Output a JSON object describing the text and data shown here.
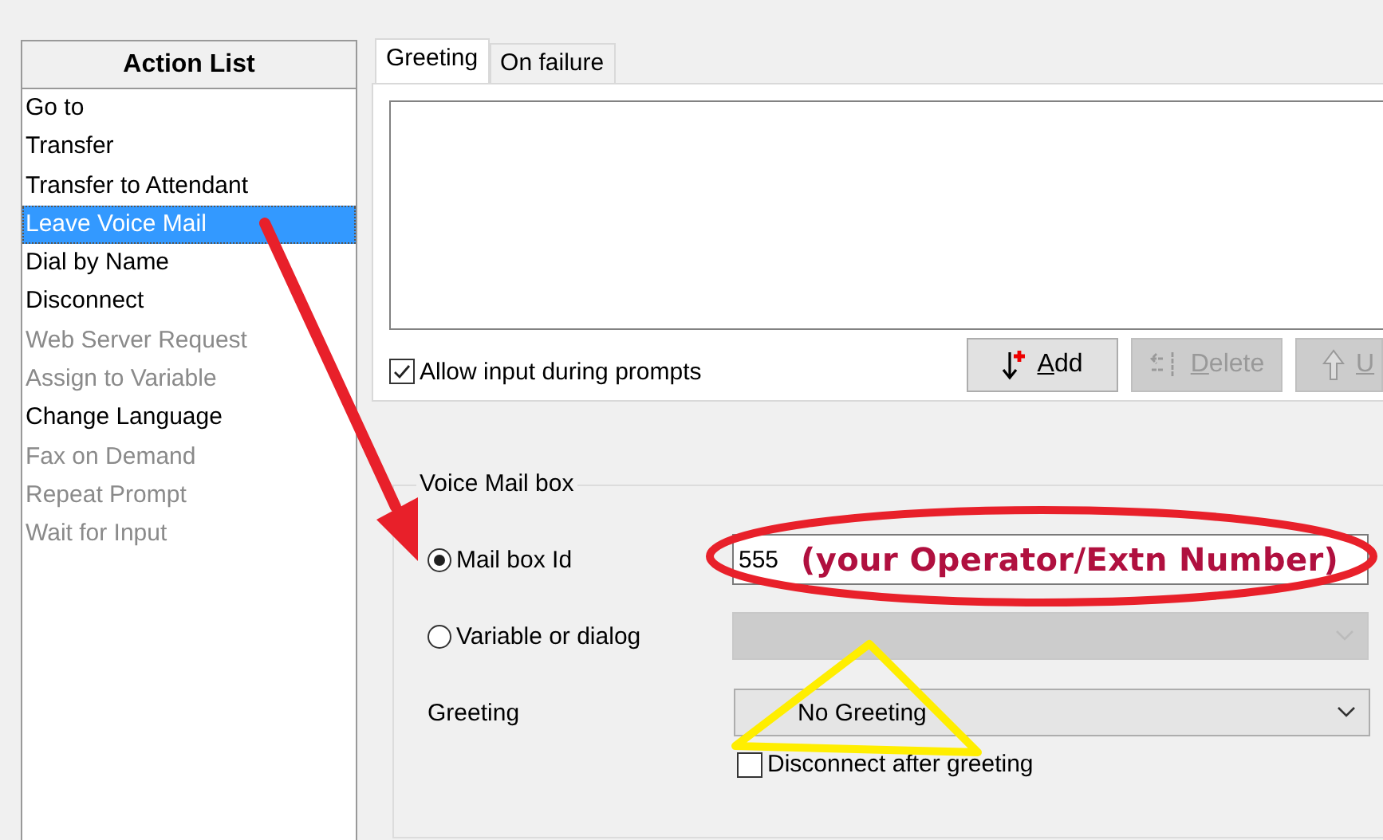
{
  "action_list": {
    "title": "Action List",
    "items": [
      {
        "label": "Go to",
        "selected": false,
        "disabled": false
      },
      {
        "label": "Transfer",
        "selected": false,
        "disabled": false
      },
      {
        "label": "Transfer to Attendant",
        "selected": false,
        "disabled": false
      },
      {
        "label": "Leave Voice Mail",
        "selected": true,
        "disabled": false
      },
      {
        "label": "Dial by Name",
        "selected": false,
        "disabled": false
      },
      {
        "label": "Disconnect",
        "selected": false,
        "disabled": false
      },
      {
        "label": "Web Server Request",
        "selected": false,
        "disabled": true
      },
      {
        "label": "Assign to Variable",
        "selected": false,
        "disabled": true
      },
      {
        "label": "Change Language",
        "selected": false,
        "disabled": false
      },
      {
        "label": "Fax on Demand",
        "selected": false,
        "disabled": true
      },
      {
        "label": "Repeat Prompt",
        "selected": false,
        "disabled": true
      },
      {
        "label": "Wait for Input",
        "selected": false,
        "disabled": true
      }
    ]
  },
  "tabs": [
    {
      "label": "Greeting",
      "selected": true
    },
    {
      "label": "On failure",
      "selected": false
    }
  ],
  "allow_input": {
    "label": "Allow input during prompts",
    "checked": true
  },
  "buttons": [
    {
      "kind": "add",
      "label": "Add",
      "disabled": false
    },
    {
      "kind": "delete",
      "label": "Delete",
      "disabled": true
    },
    {
      "kind": "up",
      "label": "U",
      "disabled": true
    }
  ],
  "voice_mail_box": {
    "title": "Voice Mail box",
    "options": [
      {
        "kind": "text",
        "label": "Mail box Id",
        "selected": true,
        "value": "555"
      },
      {
        "kind": "select",
        "label": "Variable or dialog",
        "selected": false
      }
    ],
    "greeting": {
      "label": "Greeting",
      "value": "No Greeting"
    },
    "disconnect": {
      "label": "Disconnect after greeting",
      "checked": false
    }
  },
  "annotation": {
    "text": "(your Operator/Extn Number)"
  }
}
